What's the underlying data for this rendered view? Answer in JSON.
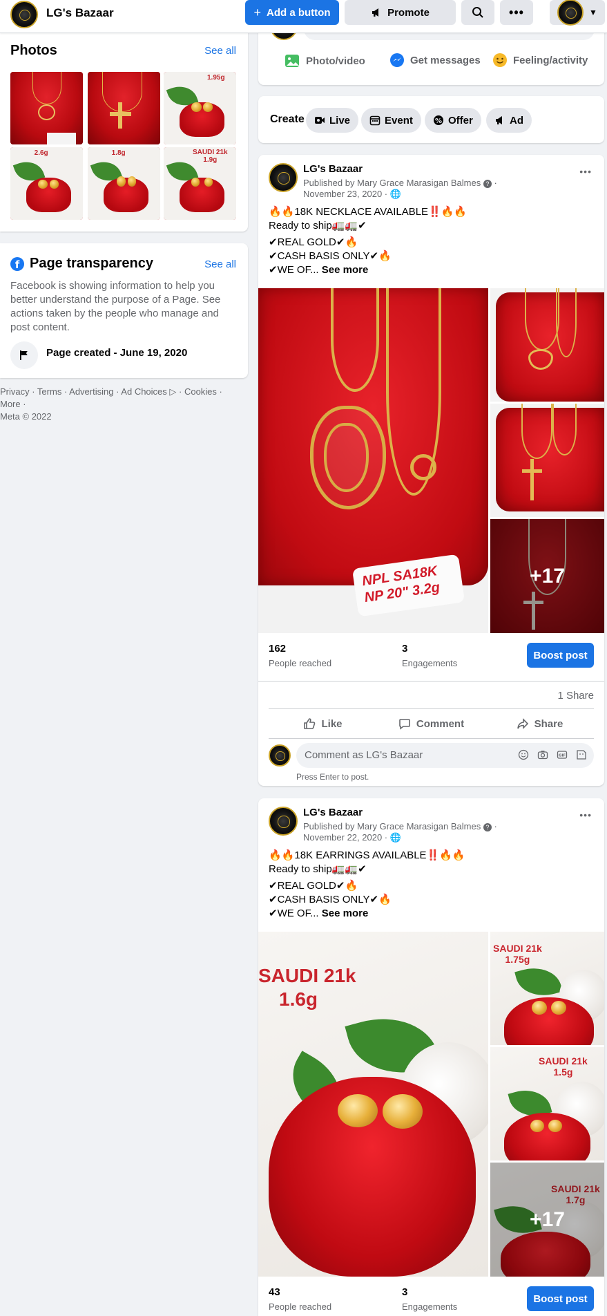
{
  "topbar": {
    "page_name": "LG's Bazaar",
    "add_button": "Add a button",
    "promote_button": "Promote",
    "search_icon": "search-icon",
    "more_icon": "more-horizontal-icon"
  },
  "photos": {
    "title": "Photos",
    "see_all": "See all",
    "labels": [
      "",
      "",
      "1.95g",
      "2.6g",
      "1.8g",
      "SAUDI 21k\n1.9g"
    ]
  },
  "transparency": {
    "title": "Page transparency",
    "see_all": "See all",
    "description": "Facebook is showing information to help you better understand the purpose of a Page. See actions taken by the people who manage and post content.",
    "created": "Page created - June 19, 2020"
  },
  "footer": {
    "links": "Privacy · Terms · Advertising · Ad Choices ▷ · Cookies · More ·",
    "copyright": "Meta © 2022"
  },
  "composer": {
    "photo_video": "Photo/video",
    "get_messages": "Get messages",
    "feeling": "Feeling/activity"
  },
  "create": {
    "label": "Create",
    "chips": [
      "Live",
      "Event",
      "Offer",
      "Ad"
    ]
  },
  "posts": [
    {
      "author": "LG's Bazaar",
      "published_by": "Published by Mary Grace Marasigan Balmes",
      "date": "November 23, 2020",
      "line1": "🔥🔥18K NECKLACE AVAILABLE‼️🔥🔥",
      "line2": "Ready to ship🚛🚛✔",
      "line3": "✔REAL GOLD✔🔥",
      "line4": "✔CASH BASIS ONLY✔🔥",
      "line5": "✔WE OF...",
      "see_more": "See more",
      "more_photos": "+17",
      "tag_text": "NPL SA18K NP 20\" 3.2g",
      "people_reached": "162",
      "people_reached_label": "People reached",
      "engagements": "3",
      "engagements_label": "Engagements",
      "boost": "Boost post",
      "shares": "1 Share",
      "like": "Like",
      "comment": "Comment",
      "share": "Share",
      "comment_placeholder": "Comment as LG's Bazaar",
      "press_enter": "Press Enter to post."
    },
    {
      "author": "LG's Bazaar",
      "published_by": "Published by Mary Grace Marasigan Balmes",
      "date": "November 22, 2020",
      "line1": "🔥🔥18K EARRINGS AVAILABLE‼️🔥🔥",
      "line2": "Ready to ship🚛🚛✔",
      "line3": "✔REAL GOLD✔🔥",
      "line4": "✔CASH BASIS ONLY✔🔥",
      "line5": "✔WE OF...",
      "see_more": "See more",
      "more_photos": "+17",
      "main_label_1": "SAUDI 21k",
      "main_label_2": "1.6g",
      "side1_label": "SAUDI 21k\n1.75g",
      "side2_label": "SAUDI 21k\n1.5g",
      "side3_label": "SAUDI 21k\n1.7g",
      "people_reached": "43",
      "people_reached_label": "People reached",
      "engagements": "3",
      "engagements_label": "Engagements",
      "boost": "Boost post"
    }
  ],
  "colors": {
    "accent": "#1b74e4",
    "background": "#f0f2f5",
    "muted_text": "#65676b"
  }
}
